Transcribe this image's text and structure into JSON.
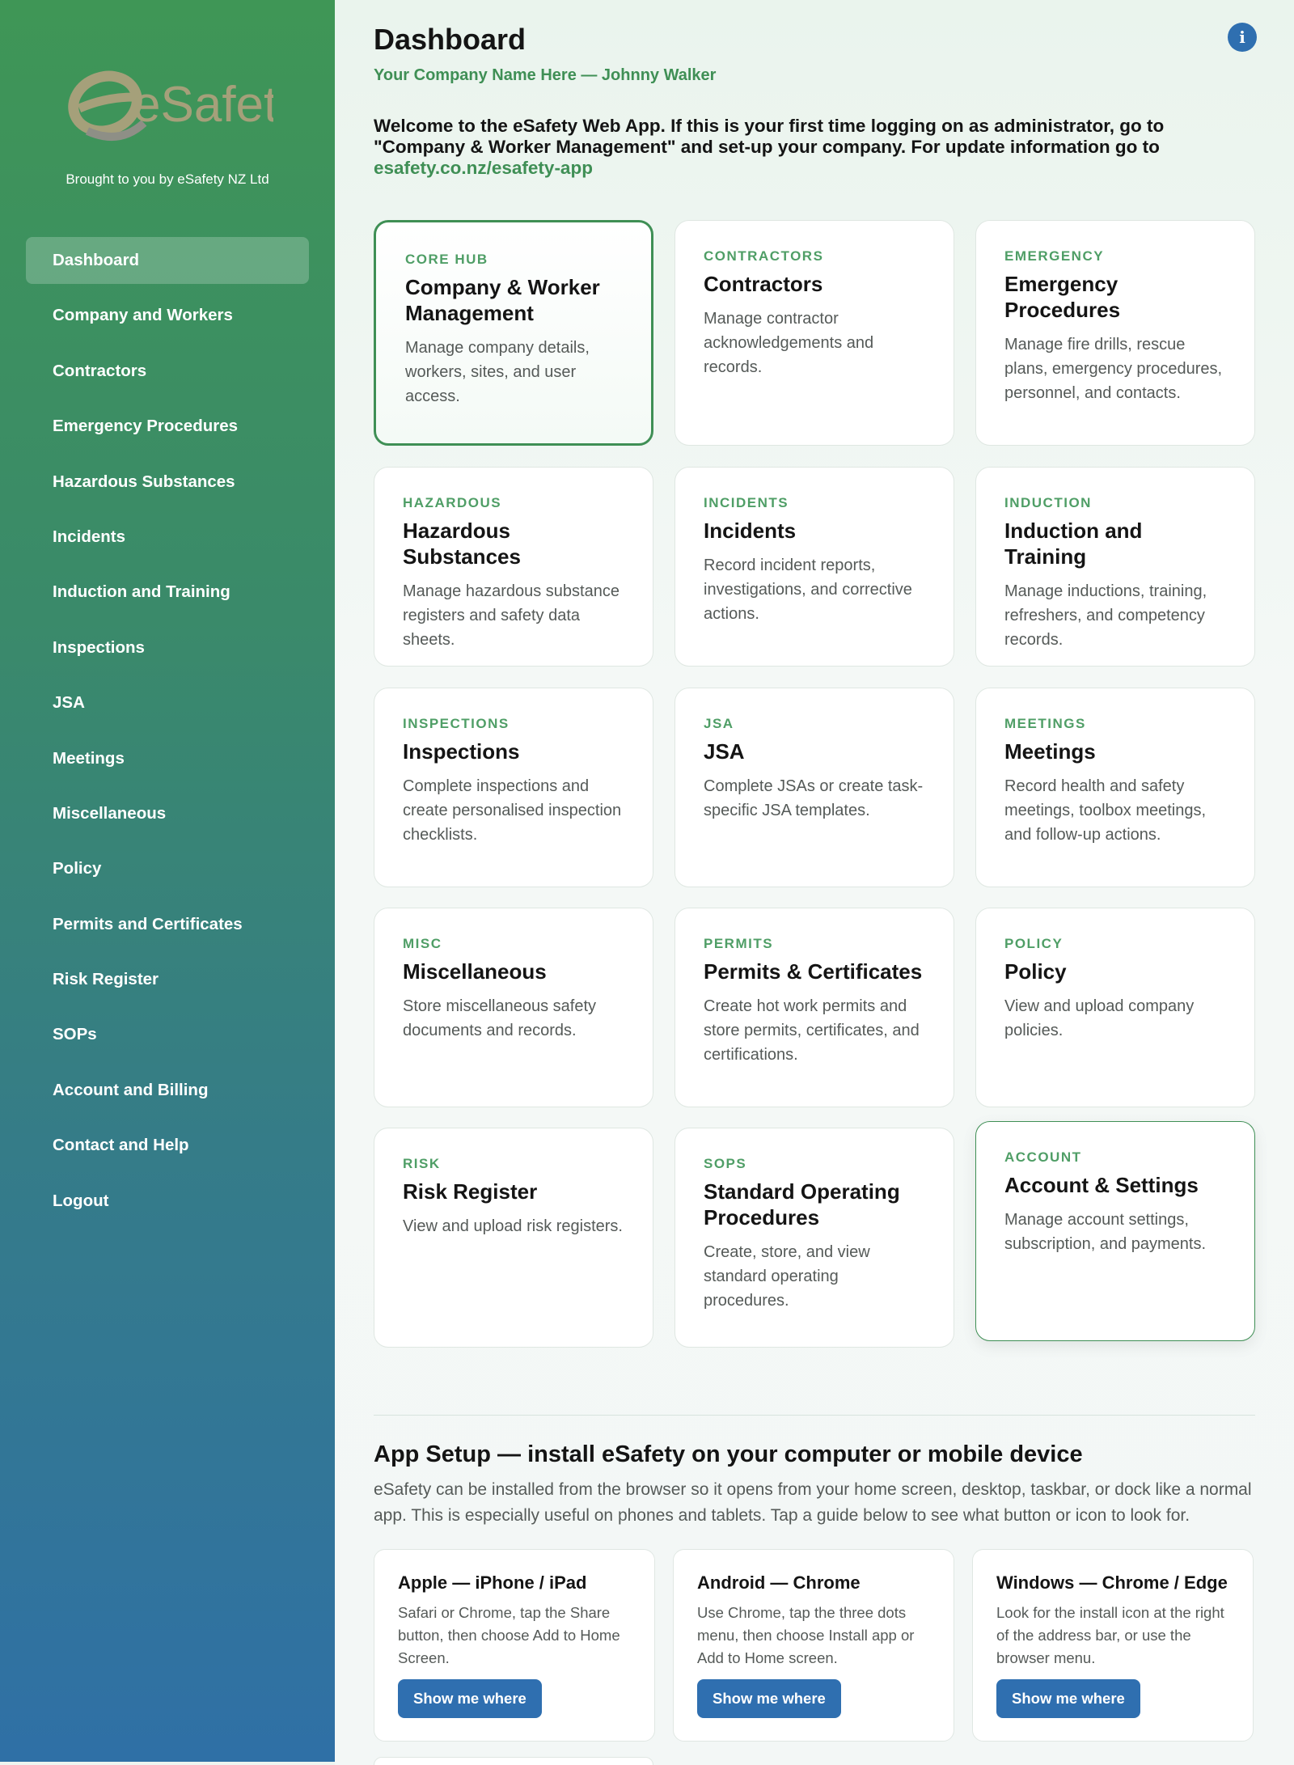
{
  "sidebar": {
    "logo_text": "eSafety",
    "tagline": "Brought to you by eSafety NZ Ltd",
    "items": [
      {
        "label": "Dashboard"
      },
      {
        "label": "Company and Workers"
      },
      {
        "label": "Contractors"
      },
      {
        "label": "Emergency Procedures"
      },
      {
        "label": "Hazardous Substances"
      },
      {
        "label": "Incidents"
      },
      {
        "label": "Induction and Training"
      },
      {
        "label": "Inspections"
      },
      {
        "label": "JSA"
      },
      {
        "label": "Meetings"
      },
      {
        "label": "Miscellaneous"
      },
      {
        "label": "Policy"
      },
      {
        "label": "Permits and Certificates"
      },
      {
        "label": "Risk Register"
      },
      {
        "label": "SOPs"
      },
      {
        "label": "Account and Billing"
      },
      {
        "label": "Contact and Help"
      },
      {
        "label": "Logout"
      }
    ],
    "active_item": "Dashboard"
  },
  "header": {
    "title": "Dashboard",
    "subtitle": "Your Company Name Here — Johnny Walker",
    "info_icon": "info-icon",
    "info_glyph": "i"
  },
  "welcome": {
    "text": "Welcome to the eSafety Web App. If this is your first time logging on as administrator, go to \"Company & Worker Management\" and set-up your company. For update information go to ",
    "link_text": "esafety.co.nz/esafety-app"
  },
  "cards": [
    {
      "tag": "CORE HUB",
      "title": "Company & Worker Management",
      "desc": "Manage company details, workers, sites, and user access."
    },
    {
      "tag": "CONTRACTORS",
      "title": "Contractors",
      "desc": "Manage contractor acknowledgements and records."
    },
    {
      "tag": "EMERGENCY",
      "title": "Emergency Procedures",
      "desc": "Manage fire drills, rescue plans, emergency procedures, personnel, and contacts."
    },
    {
      "tag": "HAZARDOUS",
      "title": "Hazardous Substances",
      "desc": "Manage hazardous substance registers and safety data sheets."
    },
    {
      "tag": "INCIDENTS",
      "title": "Incidents",
      "desc": "Record incident reports, investigations, and corrective actions."
    },
    {
      "tag": "INDUCTION",
      "title": "Induction and Training",
      "desc": "Manage inductions, training, refreshers, and competency records."
    },
    {
      "tag": "INSPECTIONS",
      "title": "Inspections",
      "desc": "Complete inspections and create personalised inspection checklists."
    },
    {
      "tag": "JSA",
      "title": "JSA",
      "desc": "Complete JSAs or create task-specific JSA templates."
    },
    {
      "tag": "MEETINGS",
      "title": "Meetings",
      "desc": "Record health and safety meetings, toolbox meetings, and follow-up actions."
    },
    {
      "tag": "MISC",
      "title": "Miscellaneous",
      "desc": "Store miscellaneous safety documents and records."
    },
    {
      "tag": "PERMITS",
      "title": "Permits & Certificates",
      "desc": "Create hot work permits and store permits, certificates, and certifications."
    },
    {
      "tag": "POLICY",
      "title": "Policy",
      "desc": "View and upload company policies."
    },
    {
      "tag": "RISK",
      "title": "Risk Register",
      "desc": "View and upload risk registers."
    },
    {
      "tag": "SOPS",
      "title": "Standard Operating Procedures",
      "desc": "Create, store, and view standard operating procedures."
    },
    {
      "tag": "ACCOUNT",
      "title": "Account & Settings",
      "desc": "Manage account settings, subscription, and payments."
    }
  ],
  "app_setup": {
    "title": "App Setup — install eSafety on your computer or mobile device",
    "desc": "eSafety can be installed from the browser so it opens from your home screen, desktop, taskbar, or dock like a normal app. This is especially useful on phones and tablets. Tap a guide below to see what button or icon to look for.",
    "guides": [
      {
        "title": "Apple — iPhone / iPad",
        "desc": "Safari or Chrome, tap the Share button, then choose Add to Home Screen.",
        "button": "Show me where"
      },
      {
        "title": "Android — Chrome",
        "desc": "Use Chrome, tap the three dots menu, then choose Install app or Add to Home screen.",
        "button": "Show me where"
      },
      {
        "title": "Windows — Chrome / Edge",
        "desc": "Look for the install icon at the right of the address bar, or use the browser menu.",
        "button": "Show me where"
      }
    ]
  },
  "colors": {
    "accent_green": "#3f8f55",
    "button_blue": "#2f6fb0",
    "sidebar_top": "#3f9656",
    "sidebar_bottom": "#2f70a6"
  }
}
